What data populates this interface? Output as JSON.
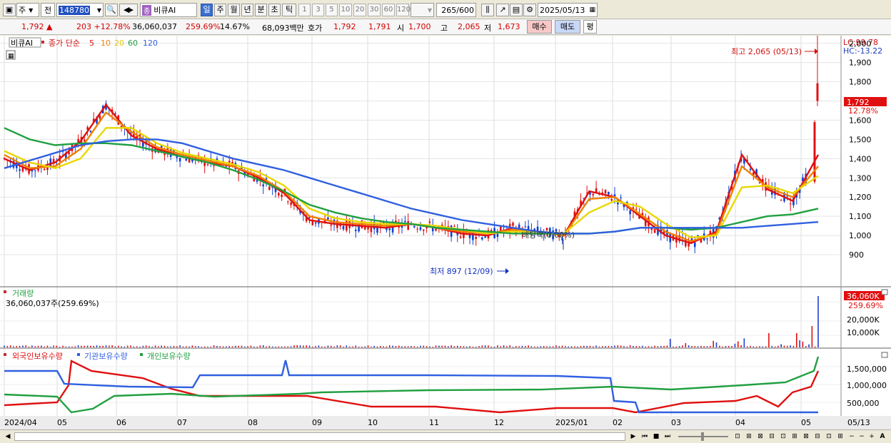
{
  "toolbar": {
    "market": "주",
    "prev_label": "전",
    "code": "148780",
    "stock_name": "비큐AI",
    "stock_badge": "종",
    "periods": [
      "일",
      "주",
      "월",
      "년",
      "분",
      "초",
      "틱"
    ],
    "active_period": "일",
    "intervals": [
      "1",
      "3",
      "5",
      "10",
      "20",
      "30",
      "60",
      "120"
    ],
    "count": "265",
    "count_total": "/600",
    "date": "2025/05/13"
  },
  "quote": {
    "price": "1,792",
    "arrow": "▲",
    "change": "203",
    "change_pct": "+12.78%",
    "volume": "36,060,037",
    "volume_pct": "259.69%",
    "turnover": "14.67%",
    "amount": "68,093백만",
    "bid_label": "호가",
    "ask_price": "1,792",
    "bid_price": "1,791",
    "open_label": "시",
    "open": "1,700",
    "high_label": "고",
    "high": "2,065",
    "low_label": "저",
    "low": "1,673",
    "buy_label": "매수",
    "sell_label": "매도",
    "avg_label": "평"
  },
  "price_panel": {
    "legend_name": "비큐AI",
    "legend_ma": "종가 단순",
    "ma_periods": [
      "5",
      "10",
      "20",
      "60",
      "120"
    ],
    "ma_colors": {
      "5": "#e01010",
      "10": "#f08000",
      "20": "#e8d800",
      "60": "#20a040",
      "120": "#3060e0"
    },
    "lc": "LC:99.78",
    "hc": "HC:-13.22",
    "y_ticks": [
      "2,000",
      "1,900",
      "1,800",
      "1,700",
      "1,600",
      "1,500",
      "1,400",
      "1,300",
      "1,200",
      "1,100",
      "1,000",
      "900"
    ],
    "current_price": "1,792",
    "current_pct": "12.78%",
    "high_annotation": "최고 2,065 (05/13)",
    "low_annotation": "최저 897 (12/09)",
    "dividend_annotation": "배당락(0.00%)"
  },
  "volume_panel": {
    "title": "거래량",
    "value": "36,060,037주(259.69%)",
    "y_ticks": [
      "20,000K",
      "10,000K"
    ],
    "current": "36,060K",
    "current_pct": "259.69%"
  },
  "holding_panel": {
    "series": [
      {
        "name": "외국인보유수량",
        "color": "#e01010"
      },
      {
        "name": "기관보유수량",
        "color": "#3060e0"
      },
      {
        "name": "개인보유수량",
        "color": "#20a040"
      }
    ],
    "y_ticks": [
      "1,500,000",
      "1,000,000",
      "500,000"
    ]
  },
  "x_axis": {
    "labels": [
      "2024/04",
      "05",
      "06",
      "07",
      "08",
      "09",
      "10",
      "11",
      "12",
      "2025/01",
      "02",
      "03",
      "04",
      "05"
    ],
    "right_label": "05/13"
  },
  "chart_data": {
    "type": "line",
    "title": "",
    "x": [
      "2024/04",
      "05",
      "06",
      "07",
      "08",
      "09",
      "10",
      "11",
      "12",
      "2025/01",
      "02",
      "03",
      "04",
      "05"
    ],
    "ylim": [
      850,
      2080
    ],
    "series": [
      {
        "name": "5",
        "values": [
          1400,
          1340,
          1380,
          1490,
          1680,
          1520,
          1450,
          1410,
          1380,
          1360,
          1300,
          1220,
          1080,
          1060,
          1050,
          1040,
          1060,
          1040,
          1010,
          1000,
          1040,
          1020,
          1000,
          1230,
          1200,
          1100,
          1000,
          960,
          1020,
          1420,
          1240,
          1180,
          1420
        ]
      },
      {
        "name": "10",
        "values": [
          1420,
          1350,
          1360,
          1450,
          1640,
          1540,
          1460,
          1420,
          1390,
          1360,
          1310,
          1230,
          1100,
          1070,
          1060,
          1050,
          1060,
          1040,
          1020,
          1010,
          1030,
          1020,
          1000,
          1190,
          1200,
          1110,
          1020,
          970,
          1010,
          1360,
          1250,
          1200,
          1360
        ]
      },
      {
        "name": "20",
        "values": [
          1440,
          1380,
          1350,
          1400,
          1560,
          1560,
          1480,
          1430,
          1400,
          1370,
          1330,
          1260,
          1140,
          1090,
          1070,
          1060,
          1060,
          1050,
          1030,
          1010,
          1020,
          1020,
          1010,
          1120,
          1180,
          1150,
          1060,
          990,
          1000,
          1250,
          1260,
          1220,
          1310
        ]
      },
      {
        "name": "60",
        "values": [
          1560,
          1500,
          1470,
          1480,
          1480,
          1470,
          1440,
          1410,
          1380,
          1340,
          1290,
          1230,
          1160,
          1120,
          1090,
          1070,
          1060,
          1040,
          1030,
          1020,
          1010,
          1010,
          1010,
          1010,
          1020,
          1040,
          1040,
          1030,
          1040,
          1070,
          1100,
          1110,
          1140
        ]
      },
      {
        "name": "120",
        "values": [
          1350,
          1390,
          1430,
          1470,
          1490,
          1500,
          1500,
          1480,
          1440,
          1400,
          1370,
          1340,
          1300,
          1260,
          1220,
          1180,
          1140,
          1110,
          1080,
          1060,
          1040,
          1020,
          1010,
          1010,
          1020,
          1040,
          1040,
          1040,
          1040,
          1040,
          1050,
          1060,
          1070
        ]
      }
    ]
  }
}
